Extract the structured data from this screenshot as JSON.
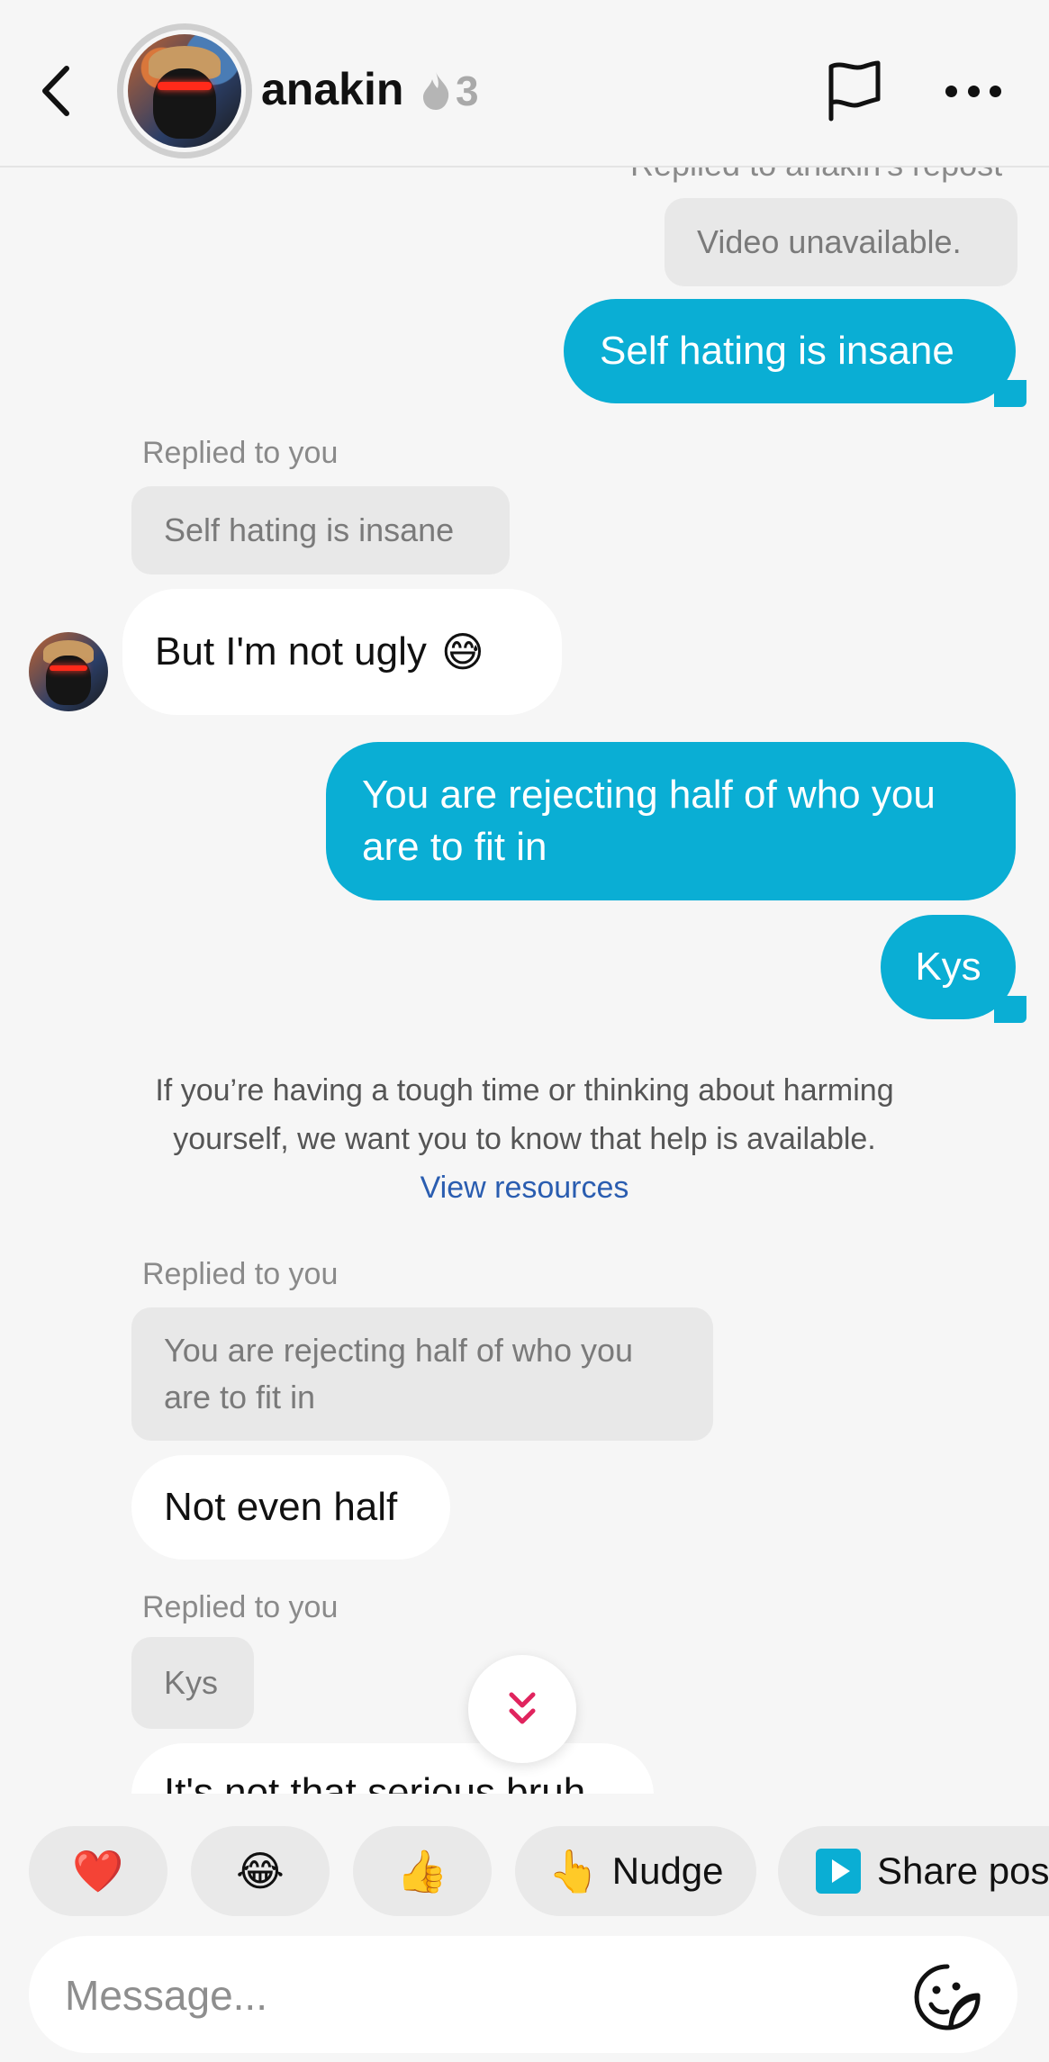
{
  "header": {
    "username": "anakin",
    "streak_count": "3"
  },
  "messages": {
    "top_partial_label": "Replied to anakin's repost",
    "video_quote": "Video unavailable.",
    "msg_self_hating": "Self hating is insane",
    "reply1_label": "Replied to you",
    "reply1_quote": "Self hating is insane",
    "msg_not_ugly": "But I'm not ugly",
    "msg_not_ugly_emoji": "😅",
    "msg_rejecting": "You are rejecting half of who you are to fit in",
    "msg_kys": "Kys",
    "reply2_label": "Replied to you",
    "reply2_quote": "You are rejecting half of who you are to fit in",
    "msg_not_even_half": "Not even half",
    "reply3_label": "Replied to you",
    "reply3_quote": "Kys",
    "msg_partial_bottom": "It's not that serious bruh"
  },
  "notice": {
    "line1": "If you’re having a tough time or thinking about harming",
    "line2": "yourself, we want you to know that help is available.",
    "link": "View resources"
  },
  "quick_replies": {
    "heart": "❤️",
    "laugh": "😂",
    "thumbs": "👍",
    "nudge_emoji": "👆",
    "nudge_label": "Nudge",
    "share_label": "Share post"
  },
  "composer": {
    "placeholder": "Message..."
  },
  "colors": {
    "outgoing_bubble": "#0aaed4",
    "incoming_bubble": "#ffffff",
    "quote_bg": "#e8e8e8",
    "link": "#2a5db0",
    "scroll_chevron": "#e0245e"
  }
}
